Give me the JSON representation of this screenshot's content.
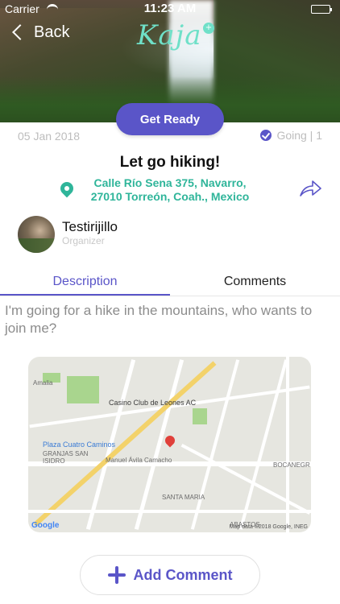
{
  "status_bar": {
    "carrier": "Carrier",
    "time": "11:23 AM"
  },
  "header": {
    "back_label": "Back",
    "logo_text": "Kaja"
  },
  "event": {
    "cta_label": "Get Ready",
    "date": "05 Jan 2018",
    "going_label": "Going | 1",
    "title": "Let go hiking!",
    "address_line1": "Calle Río Sena 375, Navarro,",
    "address_line2": "27010 Torreón, Coah., Mexico",
    "description": "I'm going for a hike in the mountains, who wants to join me?"
  },
  "organizer": {
    "name": "Testirijillo",
    "role": "Organizer"
  },
  "tabs": [
    {
      "label": "Description",
      "active": true
    },
    {
      "label": "Comments",
      "active": false
    }
  ],
  "map": {
    "poi_casino": "Casino Club de Leones AC",
    "poi_plaza": "Plaza Cuatro Caminos",
    "area_granjas": "GRANJAS SAN ISIDRO",
    "area_santa_maria": "SANTA MARIA",
    "area_bocanegra": "BOCANEGR",
    "area_abastos": "ABASTOS",
    "street_avila": "Manuel Ávila Camacho",
    "street_amalia": "Amalia",
    "google": "Google",
    "attribution": "Map data ©2018 Google, INEG"
  },
  "actions": {
    "add_comment_label": "Add Comment"
  },
  "colors": {
    "accent": "#5a55c8",
    "teal": "#2fb59a"
  }
}
